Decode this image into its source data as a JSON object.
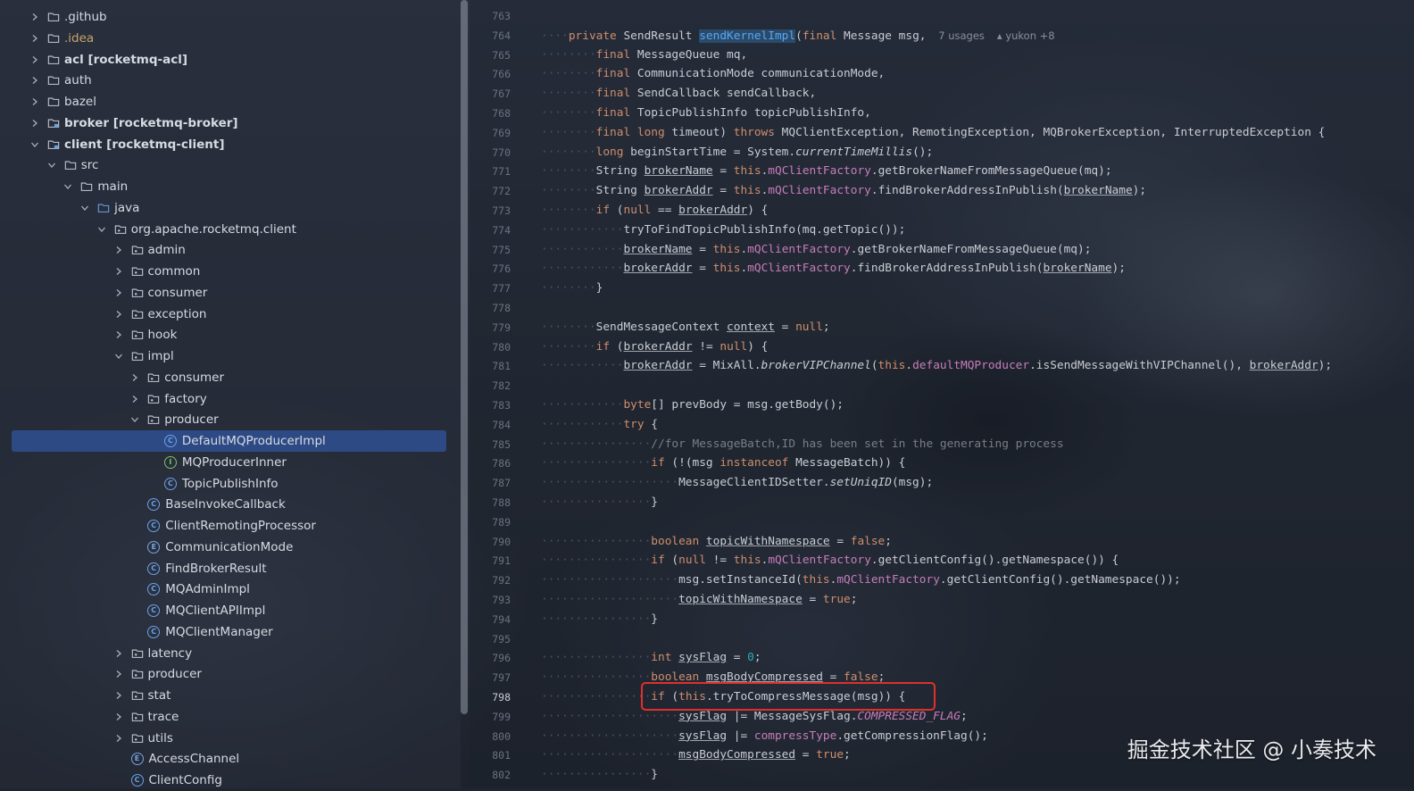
{
  "tree": {
    "items": [
      {
        "label": ".github",
        "depth": 0,
        "chevron": "collapsed",
        "icon": "folder-icon",
        "style": ""
      },
      {
        "label": ".idea",
        "depth": 0,
        "chevron": "collapsed",
        "icon": "folder-icon",
        "style": "idea"
      },
      {
        "label": "acl [rocketmq-acl]",
        "depth": 0,
        "chevron": "collapsed",
        "icon": "folder-icon",
        "style": "bold"
      },
      {
        "label": "auth",
        "depth": 0,
        "chevron": "collapsed",
        "icon": "folder-icon",
        "style": ""
      },
      {
        "label": "bazel",
        "depth": 0,
        "chevron": "collapsed",
        "icon": "folder-icon",
        "style": ""
      },
      {
        "label": "broker [rocketmq-broker]",
        "depth": 0,
        "chevron": "collapsed",
        "icon": "module-icon",
        "style": "bold"
      },
      {
        "label": "client [rocketmq-client]",
        "depth": 0,
        "chevron": "expanded",
        "icon": "module-icon",
        "style": "bold"
      },
      {
        "label": "src",
        "depth": 1,
        "chevron": "expanded",
        "icon": "folder-icon",
        "style": ""
      },
      {
        "label": "main",
        "depth": 2,
        "chevron": "expanded",
        "icon": "folder-icon",
        "style": ""
      },
      {
        "label": "java",
        "depth": 3,
        "chevron": "expanded",
        "icon": "source-folder-icon",
        "style": ""
      },
      {
        "label": "org.apache.rocketmq.client",
        "depth": 4,
        "chevron": "expanded",
        "icon": "package-icon",
        "style": ""
      },
      {
        "label": "admin",
        "depth": 5,
        "chevron": "collapsed",
        "icon": "package-icon",
        "style": ""
      },
      {
        "label": "common",
        "depth": 5,
        "chevron": "collapsed",
        "icon": "package-icon",
        "style": ""
      },
      {
        "label": "consumer",
        "depth": 5,
        "chevron": "collapsed",
        "icon": "package-icon",
        "style": ""
      },
      {
        "label": "exception",
        "depth": 5,
        "chevron": "collapsed",
        "icon": "package-icon",
        "style": ""
      },
      {
        "label": "hook",
        "depth": 5,
        "chevron": "collapsed",
        "icon": "package-icon",
        "style": ""
      },
      {
        "label": "impl",
        "depth": 5,
        "chevron": "expanded",
        "icon": "package-icon",
        "style": ""
      },
      {
        "label": "consumer",
        "depth": 6,
        "chevron": "collapsed",
        "icon": "package-icon",
        "style": ""
      },
      {
        "label": "factory",
        "depth": 6,
        "chevron": "collapsed",
        "icon": "package-icon",
        "style": ""
      },
      {
        "label": "producer",
        "depth": 6,
        "chevron": "expanded",
        "icon": "package-icon",
        "style": ""
      },
      {
        "label": "DefaultMQProducerImpl",
        "depth": 7,
        "chevron": "none",
        "icon": "class-icon",
        "style": "selected"
      },
      {
        "label": "MQProducerInner",
        "depth": 7,
        "chevron": "none",
        "icon": "interface-icon",
        "style": ""
      },
      {
        "label": "TopicPublishInfo",
        "depth": 7,
        "chevron": "none",
        "icon": "class-icon",
        "style": ""
      },
      {
        "label": "BaseInvokeCallback",
        "depth": 6,
        "chevron": "none",
        "icon": "class-icon",
        "style": ""
      },
      {
        "label": "ClientRemotingProcessor",
        "depth": 6,
        "chevron": "none",
        "icon": "class-icon",
        "style": ""
      },
      {
        "label": "CommunicationMode",
        "depth": 6,
        "chevron": "none",
        "icon": "enum-icon",
        "style": ""
      },
      {
        "label": "FindBrokerResult",
        "depth": 6,
        "chevron": "none",
        "icon": "class-icon",
        "style": ""
      },
      {
        "label": "MQAdminImpl",
        "depth": 6,
        "chevron": "none",
        "icon": "class-icon",
        "style": ""
      },
      {
        "label": "MQClientAPIImpl",
        "depth": 6,
        "chevron": "none",
        "icon": "class-icon",
        "style": ""
      },
      {
        "label": "MQClientManager",
        "depth": 6,
        "chevron": "none",
        "icon": "class-icon",
        "style": ""
      },
      {
        "label": "latency",
        "depth": 5,
        "chevron": "collapsed",
        "icon": "package-icon",
        "style": ""
      },
      {
        "label": "producer",
        "depth": 5,
        "chevron": "collapsed",
        "icon": "package-icon",
        "style": ""
      },
      {
        "label": "stat",
        "depth": 5,
        "chevron": "collapsed",
        "icon": "package-icon",
        "style": ""
      },
      {
        "label": "trace",
        "depth": 5,
        "chevron": "collapsed",
        "icon": "package-icon",
        "style": ""
      },
      {
        "label": "utils",
        "depth": 5,
        "chevron": "collapsed",
        "icon": "package-icon",
        "style": ""
      },
      {
        "label": "AccessChannel",
        "depth": 5,
        "chevron": "none",
        "icon": "enum-icon",
        "style": ""
      },
      {
        "label": "ClientConfig",
        "depth": 5,
        "chevron": "none",
        "icon": "class-icon",
        "style": ""
      }
    ]
  },
  "editor": {
    "current_line": "798",
    "hints": {
      "usages": "7 usages",
      "author": "yukon +8"
    },
    "lines": [
      {
        "n": "763",
        "indent": 0,
        "tokens": []
      },
      {
        "n": "764",
        "indent": 1,
        "tokens": [
          [
            "kw",
            "private "
          ],
          [
            "t",
            "SendResult "
          ],
          [
            "fnhl",
            "sendKernelImpl"
          ],
          [
            "t",
            "("
          ],
          [
            "kw",
            "final "
          ],
          [
            "t",
            "Message msg, "
          ]
        ],
        "hints": true
      },
      {
        "n": "765",
        "indent": 2,
        "tokens": [
          [
            "kw",
            "final "
          ],
          [
            "t",
            "MessageQueue mq,"
          ]
        ]
      },
      {
        "n": "766",
        "indent": 2,
        "tokens": [
          [
            "kw",
            "final "
          ],
          [
            "t",
            "CommunicationMode communicationMode,"
          ]
        ]
      },
      {
        "n": "767",
        "indent": 2,
        "tokens": [
          [
            "kw",
            "final "
          ],
          [
            "t",
            "SendCallback sendCallback,"
          ]
        ]
      },
      {
        "n": "768",
        "indent": 2,
        "tokens": [
          [
            "kw",
            "final "
          ],
          [
            "t",
            "TopicPublishInfo topicPublishInfo,"
          ]
        ]
      },
      {
        "n": "769",
        "indent": 2,
        "tokens": [
          [
            "kw",
            "final long "
          ],
          [
            "t",
            "timeout) "
          ],
          [
            "kw",
            "throws "
          ],
          [
            "t",
            "MQClientException, RemotingException, MQBrokerException, InterruptedException {"
          ]
        ]
      },
      {
        "n": "770",
        "indent": 2,
        "tokens": [
          [
            "kw",
            "long "
          ],
          [
            "t",
            "beginStartTime = System."
          ],
          [
            "it",
            "currentTimeMillis"
          ],
          [
            "t",
            "();"
          ]
        ]
      },
      {
        "n": "771",
        "indent": 2,
        "tokens": [
          [
            "t",
            "String "
          ],
          [
            "ul",
            "brokerName"
          ],
          [
            "t",
            " = "
          ],
          [
            "kw",
            "this"
          ],
          [
            "t",
            "."
          ],
          [
            "fd",
            "mQClientFactory"
          ],
          [
            "t",
            ".getBrokerNameFromMessageQueue(mq);"
          ]
        ]
      },
      {
        "n": "772",
        "indent": 2,
        "tokens": [
          [
            "t",
            "String "
          ],
          [
            "ul",
            "brokerAddr"
          ],
          [
            "t",
            " = "
          ],
          [
            "kw",
            "this"
          ],
          [
            "t",
            "."
          ],
          [
            "fd",
            "mQClientFactory"
          ],
          [
            "t",
            ".findBrokerAddressInPublish("
          ],
          [
            "ul",
            "brokerName"
          ],
          [
            "t",
            ");"
          ]
        ]
      },
      {
        "n": "773",
        "indent": 2,
        "tokens": [
          [
            "kw",
            "if "
          ],
          [
            "t",
            "("
          ],
          [
            "kw",
            "null"
          ],
          [
            "t",
            " == "
          ],
          [
            "ul",
            "brokerAddr"
          ],
          [
            "t",
            ") {"
          ]
        ]
      },
      {
        "n": "774",
        "indent": 3,
        "tokens": [
          [
            "t",
            "tryToFindTopicPublishInfo(mq.getTopic());"
          ]
        ]
      },
      {
        "n": "775",
        "indent": 3,
        "tokens": [
          [
            "ul",
            "brokerName"
          ],
          [
            "t",
            " = "
          ],
          [
            "kw",
            "this"
          ],
          [
            "t",
            "."
          ],
          [
            "fd",
            "mQClientFactory"
          ],
          [
            "t",
            ".getBrokerNameFromMessageQueue(mq);"
          ]
        ]
      },
      {
        "n": "776",
        "indent": 3,
        "tokens": [
          [
            "ul",
            "brokerAddr"
          ],
          [
            "t",
            " = "
          ],
          [
            "kw",
            "this"
          ],
          [
            "t",
            "."
          ],
          [
            "fd",
            "mQClientFactory"
          ],
          [
            "t",
            ".findBrokerAddressInPublish("
          ],
          [
            "ul",
            "brokerName"
          ],
          [
            "t",
            ");"
          ]
        ]
      },
      {
        "n": "777",
        "indent": 2,
        "tokens": [
          [
            "t",
            "}"
          ]
        ]
      },
      {
        "n": "778",
        "indent": 0,
        "tokens": []
      },
      {
        "n": "779",
        "indent": 2,
        "tokens": [
          [
            "t",
            "SendMessageContext "
          ],
          [
            "ul",
            "context"
          ],
          [
            "t",
            " = "
          ],
          [
            "kw",
            "null"
          ],
          [
            "t",
            ";"
          ]
        ]
      },
      {
        "n": "780",
        "indent": 2,
        "tokens": [
          [
            "kw",
            "if "
          ],
          [
            "t",
            "("
          ],
          [
            "ul",
            "brokerAddr"
          ],
          [
            "t",
            " != "
          ],
          [
            "kw",
            "null"
          ],
          [
            "t",
            ") {"
          ]
        ]
      },
      {
        "n": "781",
        "indent": 3,
        "tokens": [
          [
            "ul",
            "brokerAddr"
          ],
          [
            "t",
            " = MixAll."
          ],
          [
            "it",
            "brokerVIPChannel"
          ],
          [
            "t",
            "("
          ],
          [
            "kw",
            "this"
          ],
          [
            "t",
            "."
          ],
          [
            "fd",
            "defaultMQProducer"
          ],
          [
            "t",
            ".isSendMessageWithVIPChannel(), "
          ],
          [
            "ul",
            "brokerAddr"
          ],
          [
            "t",
            ");"
          ]
        ]
      },
      {
        "n": "782",
        "indent": 0,
        "tokens": []
      },
      {
        "n": "783",
        "indent": 3,
        "tokens": [
          [
            "kw",
            "byte"
          ],
          [
            "t",
            "[] prevBody = msg.getBody();"
          ]
        ]
      },
      {
        "n": "784",
        "indent": 3,
        "tokens": [
          [
            "kw",
            "try "
          ],
          [
            "t",
            "{"
          ]
        ]
      },
      {
        "n": "785",
        "indent": 4,
        "tokens": [
          [
            "cm",
            "//for MessageBatch,ID has been set in the generating process"
          ]
        ]
      },
      {
        "n": "786",
        "indent": 4,
        "tokens": [
          [
            "kw",
            "if "
          ],
          [
            "t",
            "(!(msg "
          ],
          [
            "kw",
            "instanceof "
          ],
          [
            "t",
            "MessageBatch)) {"
          ]
        ]
      },
      {
        "n": "787",
        "indent": 5,
        "tokens": [
          [
            "t",
            "MessageClientIDSetter."
          ],
          [
            "it",
            "setUniqID"
          ],
          [
            "t",
            "(msg);"
          ]
        ]
      },
      {
        "n": "788",
        "indent": 4,
        "tokens": [
          [
            "t",
            "}"
          ]
        ]
      },
      {
        "n": "789",
        "indent": 0,
        "tokens": []
      },
      {
        "n": "790",
        "indent": 4,
        "tokens": [
          [
            "kw",
            "boolean "
          ],
          [
            "ul",
            "topicWithNamespace"
          ],
          [
            "t",
            " = "
          ],
          [
            "kw",
            "false"
          ],
          [
            "t",
            ";"
          ]
        ]
      },
      {
        "n": "791",
        "indent": 4,
        "tokens": [
          [
            "kw",
            "if "
          ],
          [
            "t",
            "("
          ],
          [
            "kw",
            "null"
          ],
          [
            "t",
            " != "
          ],
          [
            "kw",
            "this"
          ],
          [
            "t",
            "."
          ],
          [
            "fd",
            "mQClientFactory"
          ],
          [
            "t",
            ".getClientConfig().getNamespace()) {"
          ]
        ]
      },
      {
        "n": "792",
        "indent": 5,
        "tokens": [
          [
            "t",
            "msg.setInstanceId("
          ],
          [
            "kw",
            "this"
          ],
          [
            "t",
            "."
          ],
          [
            "fd",
            "mQClientFactory"
          ],
          [
            "t",
            ".getClientConfig().getNamespace());"
          ]
        ]
      },
      {
        "n": "793",
        "indent": 5,
        "tokens": [
          [
            "ul",
            "topicWithNamespace"
          ],
          [
            "t",
            " = "
          ],
          [
            "kw",
            "true"
          ],
          [
            "t",
            ";"
          ]
        ]
      },
      {
        "n": "794",
        "indent": 4,
        "tokens": [
          [
            "t",
            "}"
          ]
        ]
      },
      {
        "n": "795",
        "indent": 0,
        "tokens": []
      },
      {
        "n": "796",
        "indent": 4,
        "tokens": [
          [
            "kw",
            "int "
          ],
          [
            "ul",
            "sysFlag"
          ],
          [
            "t",
            " = "
          ],
          [
            "nm",
            "0"
          ],
          [
            "t",
            ";"
          ]
        ]
      },
      {
        "n": "797",
        "indent": 4,
        "tokens": [
          [
            "kw",
            "boolean "
          ],
          [
            "ul",
            "msgBodyCompressed"
          ],
          [
            "t",
            " = "
          ],
          [
            "kw",
            "false"
          ],
          [
            "t",
            ";"
          ]
        ]
      },
      {
        "n": "798",
        "indent": 4,
        "tokens": [
          [
            "kw",
            "if "
          ],
          [
            "t",
            "("
          ],
          [
            "kw",
            "this"
          ],
          [
            "t",
            ".tryToCompressMessage(msg)) {"
          ]
        ]
      },
      {
        "n": "799",
        "indent": 5,
        "tokens": [
          [
            "ul",
            "sysFlag"
          ],
          [
            "t",
            " |= MessageSysFlag."
          ],
          [
            "cs",
            "COMPRESSED_FLAG"
          ],
          [
            "t",
            ";"
          ]
        ]
      },
      {
        "n": "800",
        "indent": 5,
        "tokens": [
          [
            "ul",
            "sysFlag"
          ],
          [
            "t",
            " |= "
          ],
          [
            "fd",
            "compressType"
          ],
          [
            "t",
            ".getCompressionFlag();"
          ]
        ]
      },
      {
        "n": "801",
        "indent": 5,
        "tokens": [
          [
            "ul",
            "msgBodyCompressed"
          ],
          [
            "t",
            " = "
          ],
          [
            "kw",
            "true"
          ],
          [
            "t",
            ";"
          ]
        ]
      },
      {
        "n": "802",
        "indent": 4,
        "tokens": [
          [
            "t",
            "}"
          ]
        ]
      }
    ]
  },
  "watermark": "掘金技术社区 @ 小奏技术",
  "colors": {
    "keyword": "#cf8e6d",
    "field": "#c77dbb",
    "selection": "#2e4a85",
    "highlight_box": "#e0302c"
  }
}
